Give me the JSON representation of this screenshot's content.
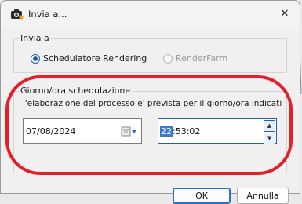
{
  "window": {
    "title": "Invia a...",
    "close_glyph": "✕"
  },
  "send_to": {
    "legend": "Invia a",
    "options": [
      {
        "label": "Schedulatore Rendering",
        "selected": true,
        "enabled": true
      },
      {
        "label": "RenderFarm",
        "selected": false,
        "enabled": false
      }
    ]
  },
  "schedule": {
    "legend": "Giorno/ora schedulazione",
    "info": "l'elaborazione del processo e' prevista per il giorno/ora indicati",
    "date_value": "07/08/2024",
    "time_hour": "22",
    "time_rest": ":53:02"
  },
  "buttons": {
    "ok": "OK",
    "cancel": "Annulla"
  },
  "icons": {
    "app": "camera-icon",
    "close": "close-icon",
    "calendar": "calendar-icon",
    "spin_up": "chevron-up-icon",
    "spin_down": "chevron-down-icon"
  },
  "colors": {
    "selection": "#3b78d6",
    "annotation_ring": "#e3202a",
    "accent": "#1e5fb3"
  }
}
